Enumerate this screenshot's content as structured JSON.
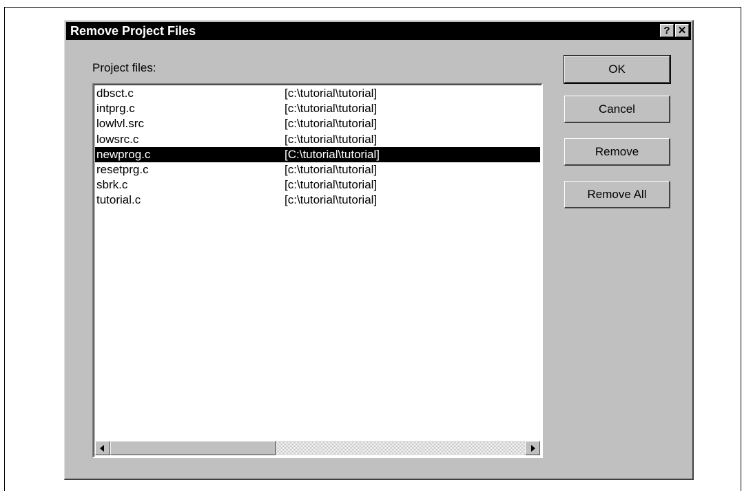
{
  "dialog": {
    "title": "Remove Project Files",
    "help_glyph": "?",
    "close_glyph": "✕"
  },
  "list": {
    "label": "Project files:",
    "selected_index": 4,
    "files": [
      {
        "name": "dbsct.c",
        "path": "[c:\\tutorial\\tutorial]"
      },
      {
        "name": "intprg.c",
        "path": "[c:\\tutorial\\tutorial]"
      },
      {
        "name": "lowlvl.src",
        "path": "[c:\\tutorial\\tutorial]"
      },
      {
        "name": "lowsrc.c",
        "path": "[c:\\tutorial\\tutorial]"
      },
      {
        "name": "newprog.c",
        "path": "[C:\\tutorial\\tutorial]"
      },
      {
        "name": "resetprg.c",
        "path": "[c:\\tutorial\\tutorial]"
      },
      {
        "name": "sbrk.c",
        "path": "[c:\\tutorial\\tutorial]"
      },
      {
        "name": "tutorial.c",
        "path": "[c:\\tutorial\\tutorial]"
      }
    ]
  },
  "buttons": {
    "ok": "OK",
    "cancel": "Cancel",
    "remove": "Remove",
    "remove_all": "Remove All"
  }
}
